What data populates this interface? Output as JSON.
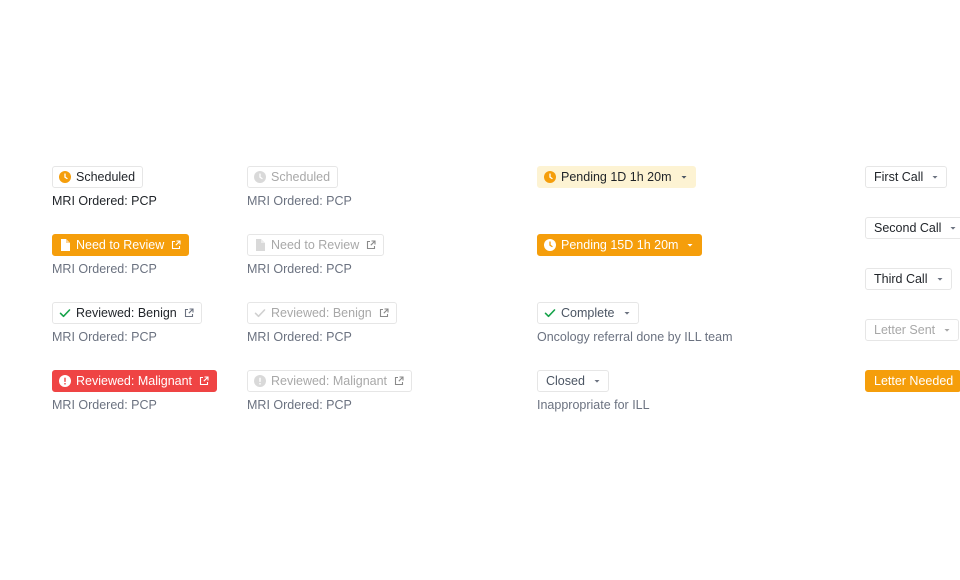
{
  "col1": {
    "scheduled": "Scheduled",
    "need_review": "Need to Review",
    "benign": "Reviewed: Benign",
    "malignant": "Reviewed: Malignant",
    "sub": "MRI Ordered: PCP"
  },
  "col2": {
    "scheduled": "Scheduled",
    "need_review": "Need to Review",
    "benign": "Reviewed: Benign",
    "malignant": "Reviewed: Malignant",
    "sub": "MRI Ordered: PCP"
  },
  "col3": {
    "pending1": "Pending 1D 1h 20m",
    "pending2": "Pending 15D 1h 20m",
    "complete": "Complete",
    "complete_note": "Oncology referral done by ILL team",
    "closed": "Closed",
    "closed_note": "Inappropriate for ILL"
  },
  "col4": {
    "first_call": "First Call",
    "second_call": "Second Call",
    "third_call": "Third Call",
    "letter_sent": "Letter Sent",
    "letter_needed": "Letter Needed"
  },
  "colors": {
    "orange": "#f59e0b",
    "red": "#ef4444",
    "green": "#16a34a",
    "pale_yellow": "#fdf3d3",
    "muted": "#a8a8a8"
  },
  "icons": {
    "clock": "clock-icon",
    "document": "document-icon",
    "check": "check-icon",
    "alert": "alert-icon",
    "external_link": "external-link-icon",
    "caret": "caret-down-icon"
  }
}
